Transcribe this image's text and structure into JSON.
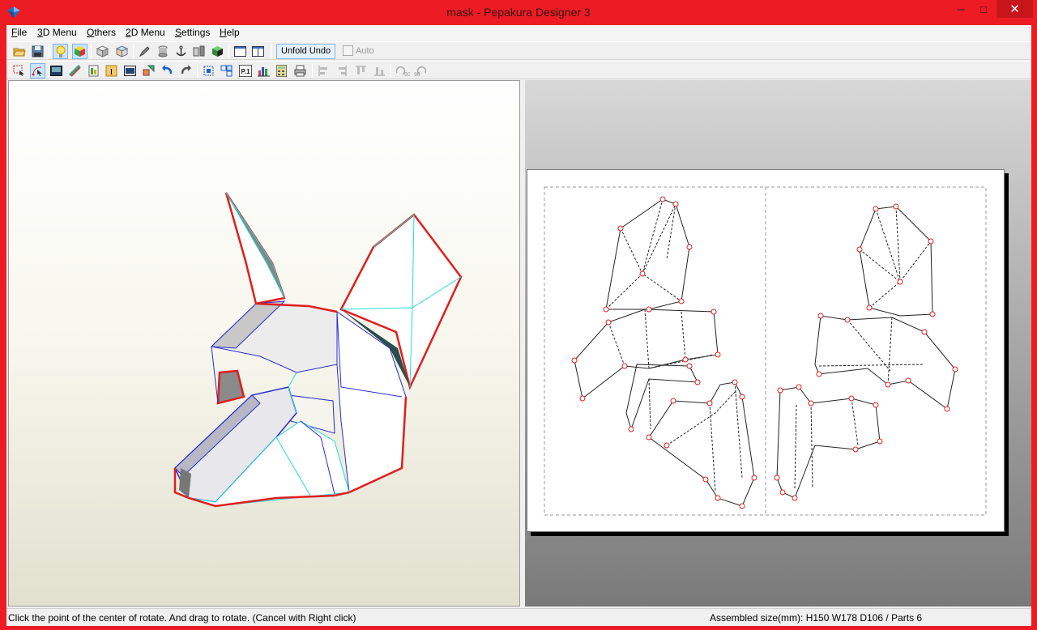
{
  "window": {
    "title": "mask - Pepakura Designer 3",
    "minimize_glyph": "─",
    "maximize_glyph": "□",
    "close_glyph": "✕",
    "accent_color": "#ed1c24"
  },
  "menu": {
    "items": [
      {
        "label": "File",
        "key": "F",
        "rest": "ile"
      },
      {
        "label": "3D Menu",
        "key": "3",
        "rest": "D Menu"
      },
      {
        "label": "Others",
        "key": "O",
        "rest": "thers"
      },
      {
        "label": "2D Menu",
        "key": "2",
        "rest": "D Menu"
      },
      {
        "label": "Settings",
        "key": "S",
        "rest": "ettings"
      },
      {
        "label": "Help",
        "key": "H",
        "rest": "elp"
      }
    ]
  },
  "toolbar1": {
    "unfold_undo_label": "Unfold Undo",
    "auto_label": "Auto",
    "auto_checked": false,
    "icons": [
      "open-folder-icon",
      "save-disk-icon",
      "light-bulb-icon",
      "color-cube-icon",
      "box-icon",
      "texture-box-icon",
      "pencil-icon",
      "cylinder-icon",
      "anchor-icon",
      "mirror-icon",
      "green-cube-icon",
      "panel-left-icon",
      "panel-right-icon"
    ]
  },
  "toolbar2": {
    "icons": [
      "select-rect-icon",
      "rotate-tool-icon",
      "picture-icon",
      "edge-join-icon",
      "paper-icon",
      "text-icon",
      "image-icon",
      "shape-icon",
      "undo-arrow-icon",
      "redo-arrow-icon",
      "arrange-icon",
      "fit-parts-icon",
      "page-number-icon",
      "chart-icon",
      "calculator-icon",
      "print-icon",
      "align-left-icon",
      "align-center-icon",
      "align-top-icon",
      "align-middle-icon",
      "rotate-90-left-icon",
      "rotate-90-right-icon"
    ],
    "page_number_glyph": "P.1",
    "rotate_left_glyph": "90",
    "rotate_right_glyph": "90"
  },
  "status": {
    "left": "Click the point of the center of rotate. And drag to rotate. (Cancel with Right click)",
    "right": "Assembled size(mm): H150 W178 D106 / Parts 6"
  }
}
